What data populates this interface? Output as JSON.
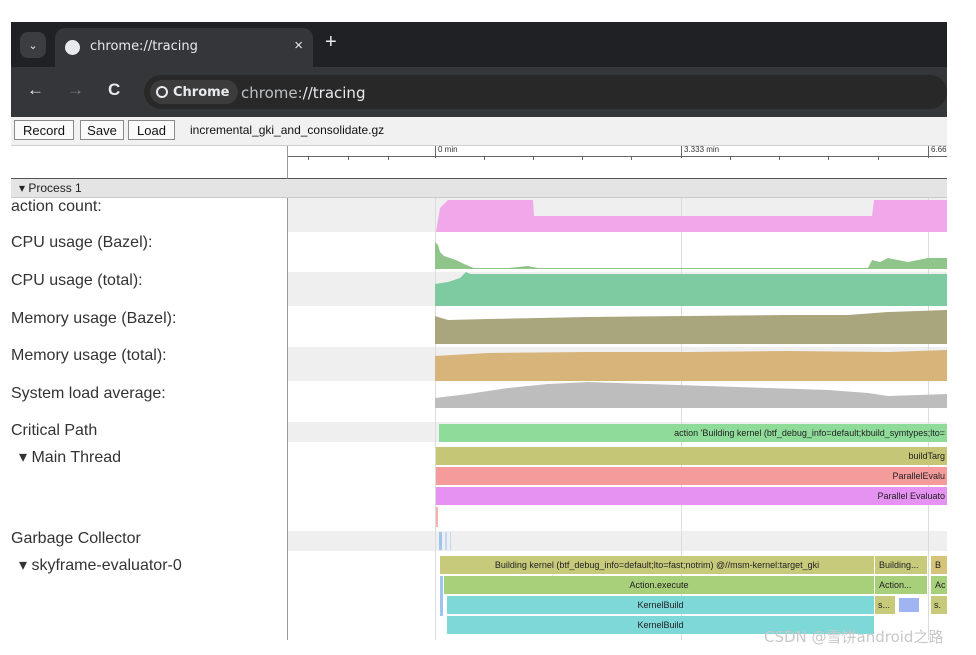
{
  "browser": {
    "tab_title": "chrome://tracing",
    "tab_close": "×",
    "new_tab": "+",
    "tab_menu_icon": "⌄",
    "back": "←",
    "forward": "→",
    "reload": "C",
    "chip_label": "Chrome",
    "url_host": "chrome:",
    "url_path": "//tracing"
  },
  "tracing": {
    "buttons": [
      "Record",
      "Save",
      "Load"
    ],
    "filename": "incremental_gki_and_consolidate.gz",
    "ruler_labels": [
      "0 min",
      "3.333 min",
      "6.66"
    ],
    "process_label": "▾ Process 1"
  },
  "tracks": {
    "labels": [
      "action count:",
      "CPU usage (Bazel):",
      "CPU usage (total):",
      "Memory usage (Bazel):",
      "Memory usage (total):",
      "System load average:",
      "Critical Path",
      "▾ Main Thread",
      "Garbage Collector",
      "▾ skyframe-evaluator-0"
    ],
    "counter_colors": {
      "action_count": "#f0a8ea",
      "cpu_bazel": "#8fc48a",
      "cpu_total": "#7ecba2",
      "mem_bazel": "#a9a57c",
      "mem_total": "#d7b47a",
      "load_avg": "#bdbdbd"
    },
    "slices": {
      "critical_path": "action 'Building kernel (btf_debug_info=default;kbuild_symtypes;lto=",
      "main_thread": [
        "buildTarg",
        "ParallelEvalu",
        "Parallel Evaluato"
      ],
      "skyframe_row1": [
        "Building kernel (btf_debug_info=default;lto=fast;notrim) @//msm-kernel:target_gki",
        "Building...",
        "B"
      ],
      "skyframe_row2": [
        "Action.execute",
        "Action...",
        "Ac"
      ],
      "skyframe_row3": [
        "KernelBuild",
        "s...",
        "s."
      ],
      "skyframe_row4": [
        "KernelBuild"
      ]
    },
    "slice_colors": {
      "critical": "#8fdc9a",
      "build_target": "#c5c676",
      "parallel_eval_red": "#f59b9b",
      "parallel_eval_purple": "#e592f2",
      "building": "#c7ca7a",
      "action_execute": "#a8cf7a",
      "kernel_build": "#7fd8d8",
      "blue_mark": "#9fb4f0"
    }
  },
  "watermark": "CSDN @雪饼android之路"
}
